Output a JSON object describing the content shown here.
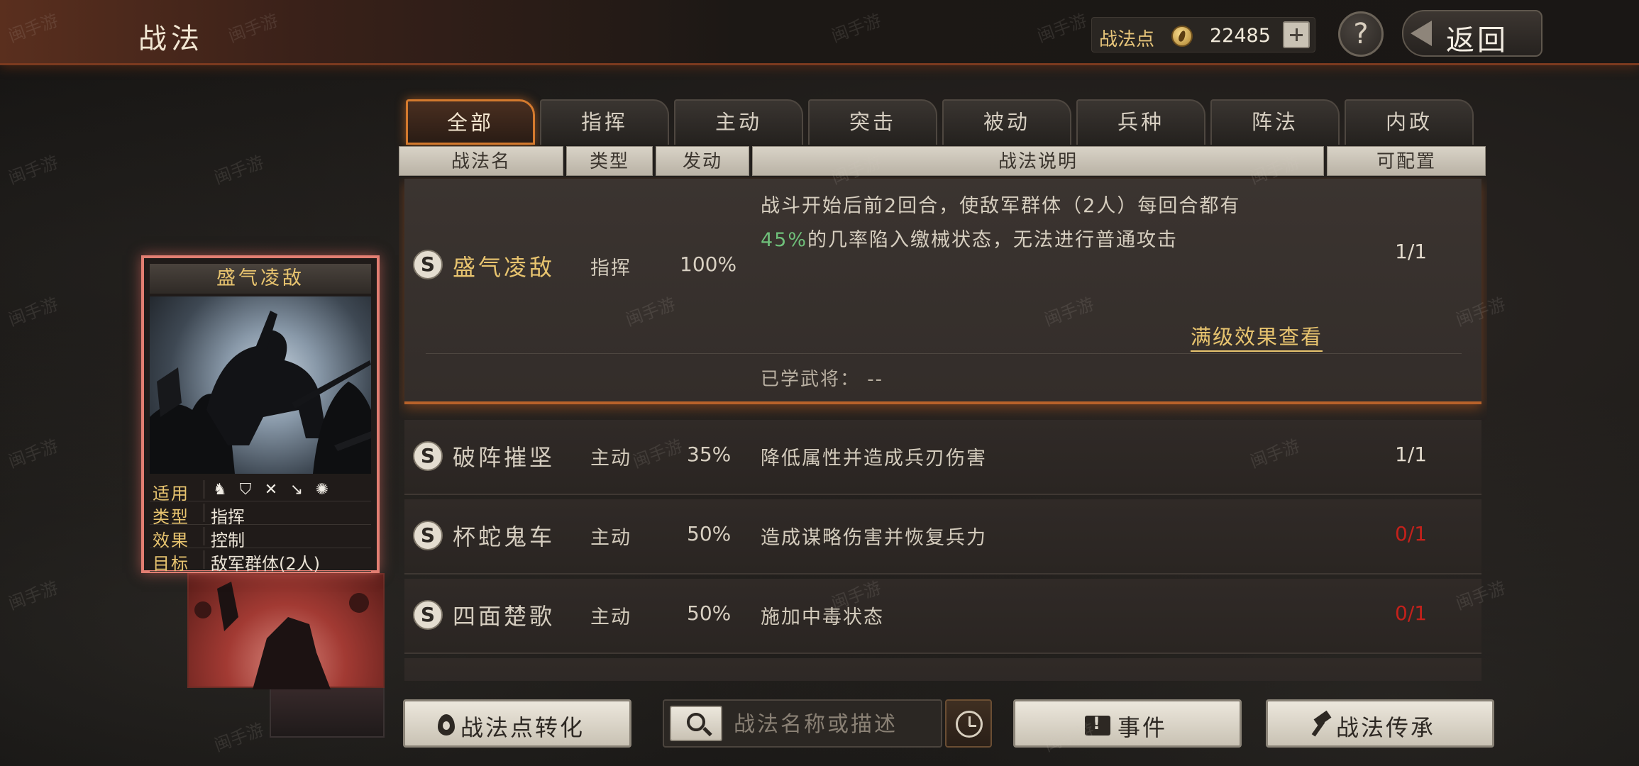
{
  "header": {
    "title": "战法",
    "points_label": "战法点",
    "points_value": "22485",
    "help_label": "?",
    "back_label": "返回"
  },
  "tabs": [
    {
      "label": "全部",
      "active": true
    },
    {
      "label": "指挥",
      "active": false
    },
    {
      "label": "主动",
      "active": false
    },
    {
      "label": "突击",
      "active": false
    },
    {
      "label": "被动",
      "active": false
    },
    {
      "label": "兵种",
      "active": false
    },
    {
      "label": "阵法",
      "active": false
    },
    {
      "label": "内政",
      "active": false
    }
  ],
  "columns": {
    "name": "战法名",
    "type": "类型",
    "trigger": "发动",
    "desc": "战法说明",
    "config": "可配置"
  },
  "selected_skill": {
    "badge": "S",
    "name": "盛气凌敌",
    "type": "指挥",
    "rate": "100%",
    "desc_line1": "战斗开始后前2回合，使敌军群体（2人）每回合都有",
    "desc_line2_highlight": "45%",
    "desc_line2_rest": "的几率陷入缴械状态，无法进行普通攻击",
    "config": "1/1",
    "full_effect_link": "满级效果查看",
    "learned_label": "已学武将：",
    "learned_value": "--"
  },
  "skills": [
    {
      "badge": "S",
      "name": "破阵摧坚",
      "type": "主动",
      "rate": "35%",
      "desc": "降低属性并造成兵刃伤害",
      "config": "1/1",
      "config_color": "#e2dacc"
    },
    {
      "badge": "S",
      "name": "杯蛇鬼车",
      "type": "主动",
      "rate": "50%",
      "desc": "造成谋略伤害并恢复兵力",
      "config": "0/1",
      "config_color": "#c4211b"
    },
    {
      "badge": "S",
      "name": "四面楚歌",
      "type": "主动",
      "rate": "50%",
      "desc": "施加中毒状态",
      "config": "0/1",
      "config_color": "#c4211b"
    }
  ],
  "card": {
    "title": "盛气凌敌",
    "apply_label": "适用",
    "unit_icons": [
      "cavalry-icon",
      "shield-icon",
      "archer-icon",
      "spear-icon",
      "siege-icon"
    ],
    "type_label": "类型",
    "type_value": "指挥",
    "effect_label": "效果",
    "effect_value": "控制",
    "target_label": "目标",
    "target_value": "敌军群体(2人)"
  },
  "bottom": {
    "convert_label": "战法点转化",
    "search_placeholder": "战法名称或描述",
    "event_label": "事件",
    "inherit_label": "战法传承"
  },
  "watermark_text": "闽手游"
}
